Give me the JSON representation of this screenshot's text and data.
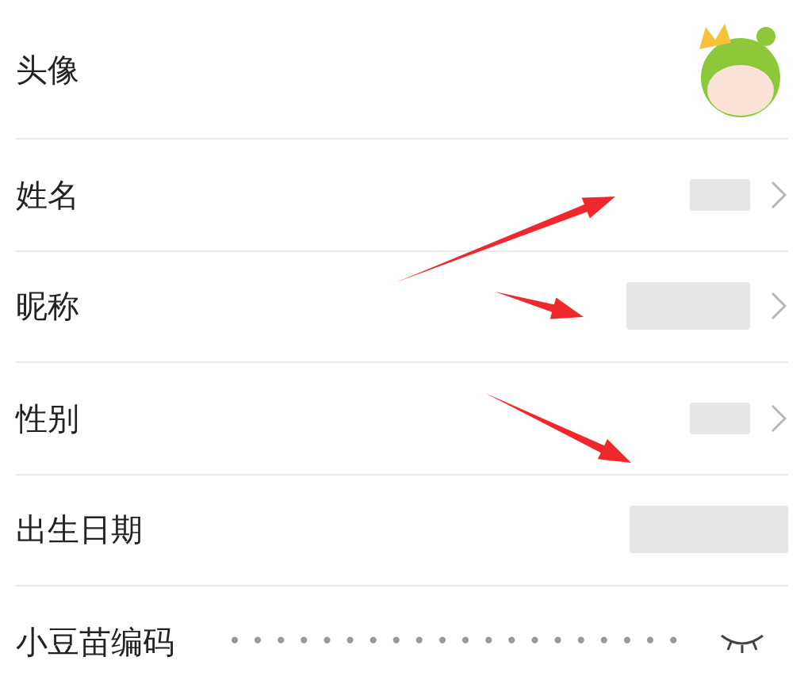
{
  "rows": [
    {
      "kind": "avatar",
      "label": "头像"
    },
    {
      "kind": "redacted_short",
      "label": "姓名",
      "chevron": true
    },
    {
      "kind": "redacted_long",
      "label": "昵称",
      "chevron": true
    },
    {
      "kind": "redacted_short",
      "label": "性别",
      "chevron": true
    },
    {
      "kind": "redacted_wide",
      "label": "出生日期",
      "chevron": false
    },
    {
      "kind": "masked",
      "label": "小豆苗编码",
      "value": "••••••••••••••••••••",
      "eye_open": false
    }
  ],
  "annotations": [
    {
      "kind": "arrow"
    },
    {
      "kind": "arrow"
    },
    {
      "kind": "arrow"
    }
  ]
}
